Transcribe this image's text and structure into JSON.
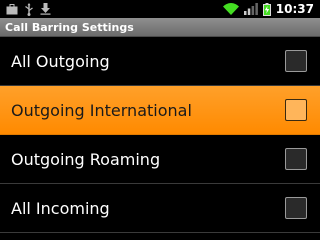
{
  "status_bar": {
    "time": "10:37",
    "icons": [
      "briefcase-icon",
      "usb-icon",
      "download-icon",
      "wifi-icon",
      "signal-icon",
      "battery-charging-icon"
    ]
  },
  "title": "Call Barring Settings",
  "items": [
    {
      "label": "All Outgoing",
      "checked": false,
      "selected": false
    },
    {
      "label": "Outgoing International",
      "checked": false,
      "selected": true
    },
    {
      "label": "Outgoing Roaming",
      "checked": false,
      "selected": false
    },
    {
      "label": "All Incoming",
      "checked": false,
      "selected": false
    }
  ],
  "colors": {
    "selection": "#ff9200",
    "background": "#000000",
    "wifi": "#44dd22"
  }
}
